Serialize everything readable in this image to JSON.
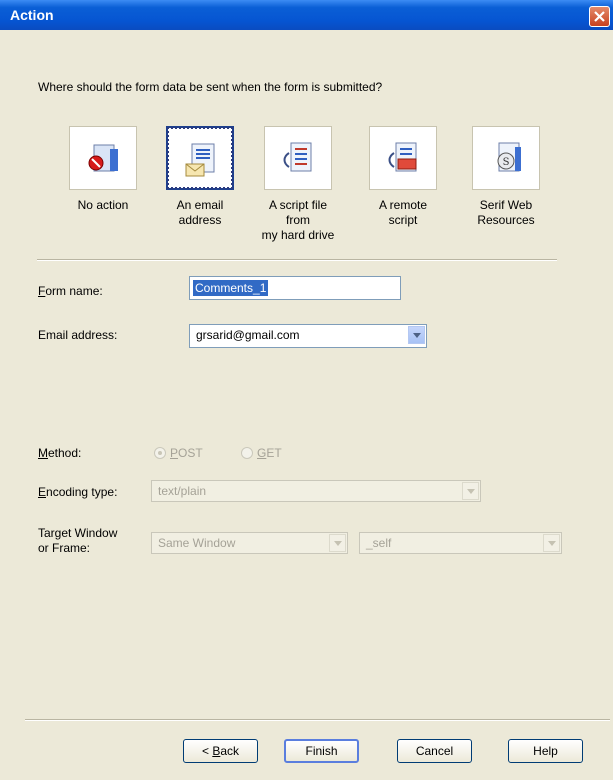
{
  "window": {
    "title": "Action"
  },
  "question": "Where should the form data be sent when the form is submitted?",
  "choices": [
    {
      "label_line1": "No action",
      "label_line2": "",
      "icon": "no-action-icon"
    },
    {
      "label_line1": "An email",
      "label_line2": "address",
      "icon": "email-document-icon",
      "selected": true
    },
    {
      "label_line1": "A script file from",
      "label_line2": "my hard drive",
      "icon": "script-file-icon"
    },
    {
      "label_line1": "A remote",
      "label_line2": "script",
      "icon": "remote-script-icon"
    },
    {
      "label_line1": "Serif Web",
      "label_line2": "Resources",
      "icon": "serif-web-resources-icon"
    }
  ],
  "form": {
    "form_name_label_accel": "F",
    "form_name_label_rest": "orm name:",
    "form_name_value": "Comments_1",
    "email_label": "Email address:",
    "email_value": "grsarid@gmail.com"
  },
  "method": {
    "label_accel": "M",
    "label_rest": "ethod:",
    "post_accel": "P",
    "post_rest": "OST",
    "get_accel": "G",
    "get_rest": "ET",
    "selected": "POST"
  },
  "encoding": {
    "label_accel": "E",
    "label_rest": "ncoding type:",
    "value": "text/plain"
  },
  "target": {
    "label_line1": "Target Window",
    "label_line2": "or Frame:",
    "window_value": "Same Window",
    "frame_value": "_self"
  },
  "buttons": {
    "back_prefix": "< ",
    "back_accel": "B",
    "back_rest": "ack",
    "finish": "Finish",
    "cancel": "Cancel",
    "help": "Help"
  },
  "colors": {
    "titlebar": "#0655d2",
    "selection": "#316ac5",
    "dialog": "#ece9d8"
  }
}
